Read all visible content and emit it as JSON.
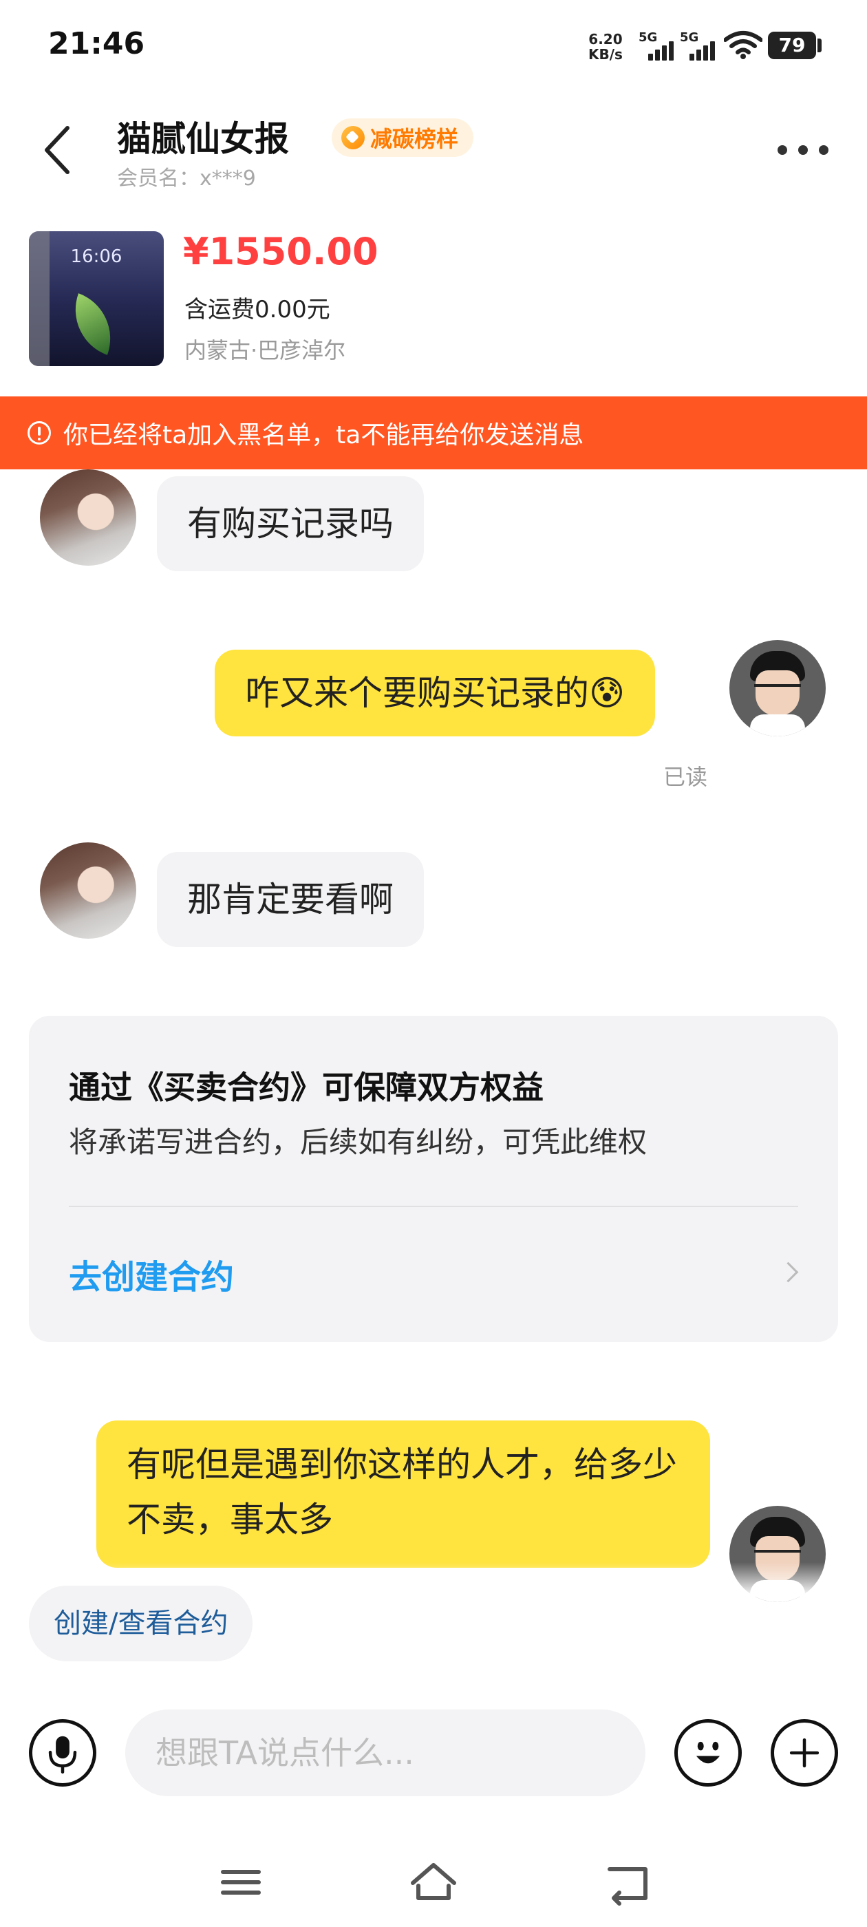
{
  "status_bar": {
    "time": "21:46",
    "net_speed_value": "6.20",
    "net_speed_unit": "KB/s",
    "sim1": "5G",
    "sim2": "5G",
    "battery": "79"
  },
  "header": {
    "seller_name": "猫腻仙女报",
    "badge": "减碳榜样",
    "member_name": "会员名：x***9"
  },
  "product": {
    "thumb_clock": "16:06",
    "price": "¥1550.00",
    "shipping": "含运费0.00元",
    "location": "内蒙古·巴彦淖尔"
  },
  "warning_banner": "你已经将ta加入黑名单，ta不能再给你发送消息",
  "messages": [
    {
      "side": "in",
      "text": "有购买记录吗"
    },
    {
      "side": "out",
      "text": "咋又来个要购买记录的",
      "emoji": "😰",
      "status": "已读"
    },
    {
      "side": "in",
      "text": "那肯定要看啊"
    },
    {
      "side": "out",
      "text": "有呢但是遇到你这样的人才，给多少不卖，事太多"
    }
  ],
  "contract_card": {
    "title": "通过《买卖合约》可保障双方权益",
    "desc": "将承诺写进合约，后续如有纠纷，可凭此维权",
    "link": "去创建合约"
  },
  "quick_chip": "创建/查看合约",
  "input_bar": {
    "placeholder": "想跟TA说点什么..."
  },
  "icons": {
    "back": "chevron-left-icon",
    "more": "more-dots-icon",
    "voice": "microphone-icon",
    "emoji": "smiley-icon",
    "plus": "plus-icon",
    "nav_menu": "menu-icon",
    "nav_home": "home-icon",
    "nav_back": "return-icon"
  },
  "colors": {
    "accent_price": "#ff4040",
    "warning_bg": "#ff5622",
    "outgoing_bubble": "#ffe33e",
    "link_blue": "#1f9bf0",
    "badge_orange": "#ff7a00"
  }
}
